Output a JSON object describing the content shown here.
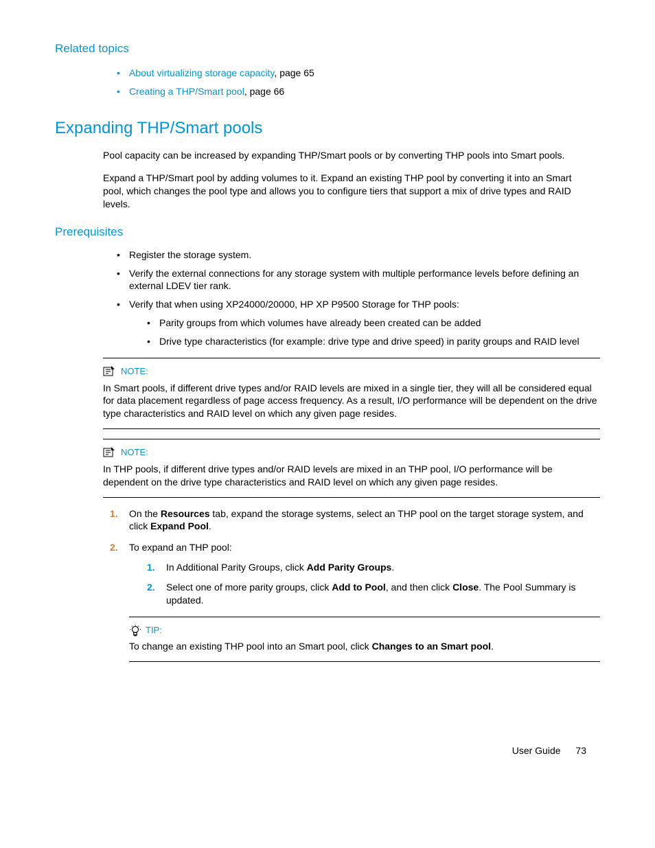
{
  "related": {
    "heading": "Related topics",
    "items": [
      {
        "link": "About virtualizing storage capacity",
        "suffix": ", page 65"
      },
      {
        "link": "Creating a THP/Smart pool",
        "suffix": ", page 66"
      }
    ]
  },
  "section": {
    "heading": "Expanding THP/Smart pools",
    "para1": "Pool capacity can be increased by expanding THP/Smart pools or by converting THP pools into Smart pools.",
    "para2": "Expand a THP/Smart pool by adding volumes to it. Expand an existing THP pool by converting it into an Smart pool, which changes the pool type and allows you to configure tiers that support a mix of drive types and RAID levels."
  },
  "prereq": {
    "heading": "Prerequisites",
    "items": {
      "0": "Register the storage system.",
      "1": "Verify the external connections for any storage system with multiple performance levels before defining an external LDEV tier rank.",
      "2": "Verify that when using XP24000/20000, HP XP P9500 Storage for THP pools:",
      "2a": "Parity groups from which volumes have already been created can be added",
      "2b": "Drive type characteristics (for example: drive type and drive speed) in parity groups and RAID level"
    }
  },
  "note1": {
    "label": "NOTE:",
    "body": "In Smart pools, if different drive types and/or RAID levels are mixed in a single tier, they will all be considered equal for data placement regardless of page access frequency. As a result, I/O performance will be dependent on the drive type characteristics and RAID level on which any given page resides."
  },
  "note2": {
    "label": "NOTE:",
    "body": "In THP pools, if different drive types and/or RAID levels are mixed in an THP pool, I/O performance will be dependent on the drive type characteristics and RAID level on which any given page resides."
  },
  "steps": {
    "s1_a": "On the ",
    "s1_b": "Resources",
    "s1_c": " tab, expand the storage systems, select an THP pool on the target storage system, and click ",
    "s1_d": "Expand Pool",
    "s1_e": ".",
    "s2": "To expand an THP pool:",
    "s2_1a": "In Additional Parity Groups, click ",
    "s2_1b": "Add Parity Groups",
    "s2_1c": ".",
    "s2_2a": "Select one of more parity groups, click ",
    "s2_2b": "Add to Pool",
    "s2_2c": ", and then click ",
    "s2_2d": "Close",
    "s2_2e": ". The Pool Summary is updated."
  },
  "tip": {
    "label": "TIP:",
    "a": "To change an existing THP pool into an Smart pool, click ",
    "b": "Changes to an Smart pool",
    "c": "."
  },
  "footer": {
    "text": "User Guide",
    "page": "73"
  }
}
